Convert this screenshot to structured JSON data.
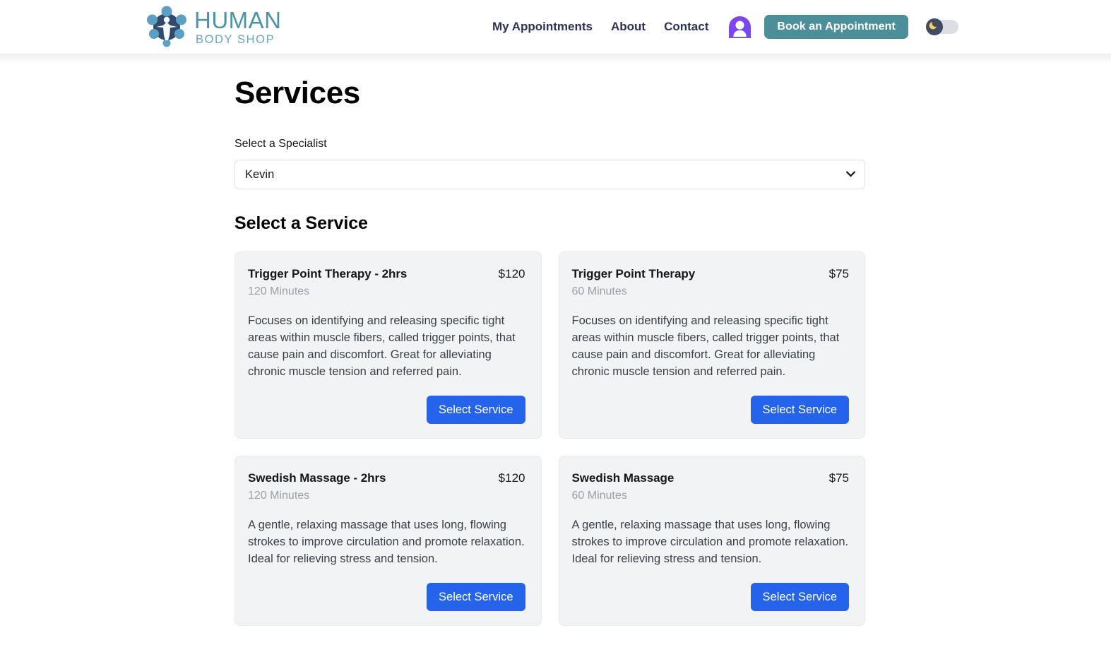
{
  "header": {
    "brand": {
      "name_top": "HUMAN",
      "name_sub": "BODY SHOP",
      "logo_icon": "molecule-human-logo-icon"
    },
    "nav_links": [
      {
        "label": "My Appointments"
      },
      {
        "label": "About"
      },
      {
        "label": "Contact"
      }
    ],
    "avatar_icon": "user-avatar-icon",
    "book_button_label": "Book an Appointment",
    "theme_toggle": {
      "icon": "moon-icon",
      "state": "dark-mode-off"
    },
    "colors": {
      "brand_teal": "#4f93a8",
      "book_button": "#4d8f98",
      "nav_text": "#2b3158",
      "avatar_purple": "#7b3ff2",
      "toggle_knob": "#434a62",
      "moon_yellow": "#f2d25c"
    }
  },
  "main": {
    "page_title": "Services",
    "specialist": {
      "label": "Select a Specialist",
      "selected": "Kevin",
      "options": [
        "Kevin"
      ],
      "chevron_icon": "chevron-down-icon"
    },
    "service_section_title": "Select a Service",
    "select_service_label": "Select Service",
    "accent_button_color": "#2563eb",
    "services": [
      {
        "title": "Trigger Point Therapy - 2hrs",
        "price": "$120",
        "duration": "120 Minutes",
        "description": "Focuses on identifying and releasing specific tight areas within muscle fibers, called trigger points, that cause pain and discomfort. Great for alleviating chronic muscle tension and referred pain."
      },
      {
        "title": "Trigger Point Therapy",
        "price": "$75",
        "duration": "60 Minutes",
        "description": "Focuses on identifying and releasing specific tight areas within muscle fibers, called trigger points, that cause pain and discomfort. Great for alleviating chronic muscle tension and referred pain."
      },
      {
        "title": "Swedish Massage - 2hrs",
        "price": "$120",
        "duration": "120 Minutes",
        "description": "A gentle, relaxing massage that uses long, flowing strokes to improve circulation and promote relaxation. Ideal for relieving stress and tension."
      },
      {
        "title": "Swedish Massage",
        "price": "$75",
        "duration": "60 Minutes",
        "description": "A gentle, relaxing massage that uses long, flowing strokes to improve circulation and promote relaxation. Ideal for relieving stress and tension."
      }
    ]
  }
}
